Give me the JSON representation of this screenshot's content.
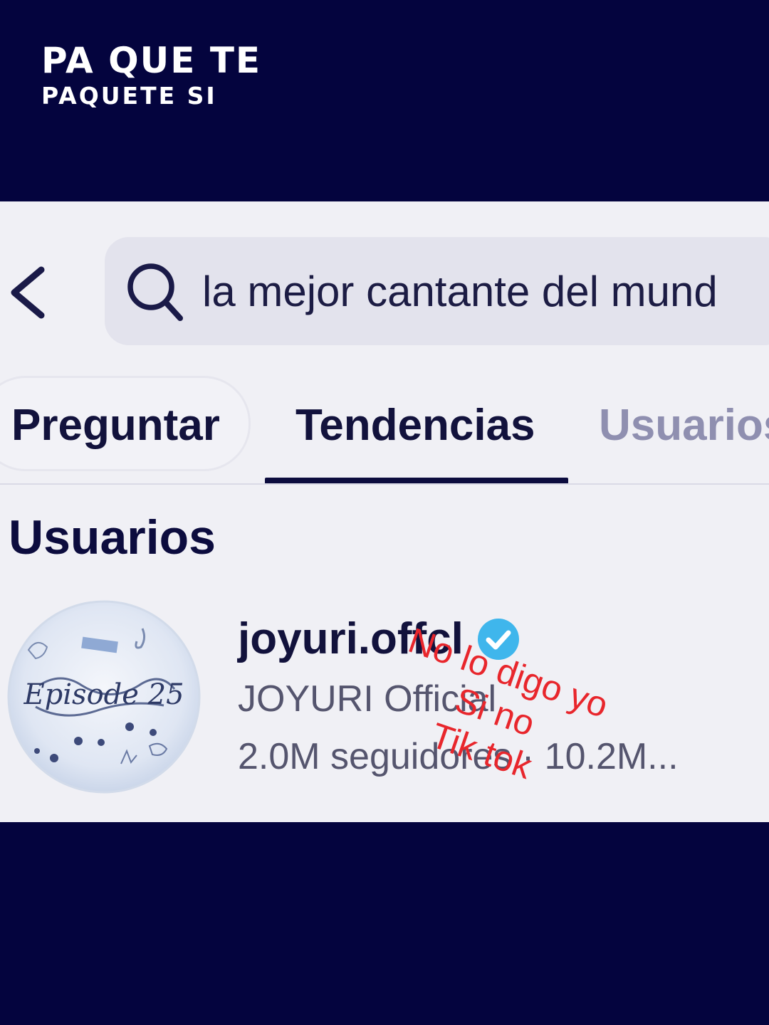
{
  "brand": {
    "line1": "PA QUE TE",
    "line2": "PAQUETE SI"
  },
  "search": {
    "query": "la mejor cantante del mund"
  },
  "tabs": [
    {
      "label": "Preguntar",
      "state": "pill"
    },
    {
      "label": "Tendencias",
      "state": "selected"
    },
    {
      "label": "Usuarios",
      "state": "inactive"
    }
  ],
  "section": {
    "title": "Usuarios"
  },
  "user_result": {
    "username": "joyuri.offcl",
    "verified": true,
    "display_name": "JOYURI Official",
    "stats": "2.0M seguidores · 10.2M...",
    "avatar_text": "Episode 25"
  },
  "overlay_caption": {
    "line1": "No lo digo yo",
    "line2": "Si no",
    "line3": "Tik tok"
  },
  "colors": {
    "frame_background": "#04043e",
    "screen_background": "#f0f0f5",
    "overlay_text": "#e8262c",
    "verified_badge": "#3fb6ec"
  }
}
